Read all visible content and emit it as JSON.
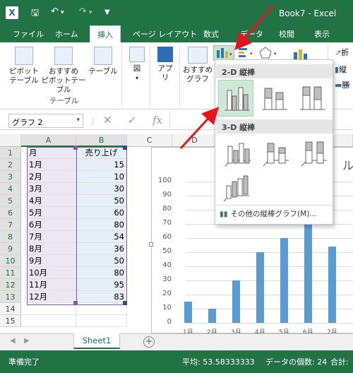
{
  "window": {
    "title": "Book7 - Excel"
  },
  "tabs": [
    "ファイル",
    "ホーム",
    "挿入",
    "ページ レイアウト",
    "数式",
    "データ",
    "校閲",
    "表示"
  ],
  "ribbon": {
    "pivot_table": "ピボット\nテーブル",
    "recommended_pivot": "おすすめ\nピボットテーブル",
    "table": "テーブル",
    "table_group": "テーブル",
    "illustrations": "図",
    "apps": "アプ\nリ",
    "recommended_charts": "おすすめ\nグラフ",
    "right_labels": [
      "折",
      "縦",
      "勝"
    ]
  },
  "formula_bar": {
    "name_box": "グラフ 2"
  },
  "grid": {
    "columns": [
      "A",
      "B",
      "C",
      "D",
      "E",
      "F",
      "G"
    ],
    "rows": [
      "1",
      "2",
      "3",
      "4",
      "5",
      "6",
      "7",
      "8",
      "9",
      "10",
      "11",
      "12",
      "13",
      "14",
      "15"
    ],
    "header": {
      "month": "月",
      "sales": "売り上げ"
    },
    "data": [
      {
        "m": "1月",
        "v": "15"
      },
      {
        "m": "2月",
        "v": "10"
      },
      {
        "m": "3月",
        "v": "30"
      },
      {
        "m": "4月",
        "v": "50"
      },
      {
        "m": "5月",
        "v": "60"
      },
      {
        "m": "6月",
        "v": "80"
      },
      {
        "m": "7月",
        "v": "54"
      },
      {
        "m": "8月",
        "v": "36"
      },
      {
        "m": "9月",
        "v": "50"
      },
      {
        "m": "10月",
        "v": "80"
      },
      {
        "m": "11月",
        "v": "95"
      },
      {
        "m": "12月",
        "v": "83"
      }
    ]
  },
  "chart_data": {
    "type": "bar",
    "categories": [
      "1月",
      "2月",
      "3月",
      "4月",
      "5月",
      "6月",
      "7月"
    ],
    "values": [
      15,
      10,
      30,
      50,
      60,
      80,
      54
    ],
    "y_ticks": [
      "100",
      "90",
      "80",
      "70",
      "60",
      "50",
      "40",
      "30",
      "20",
      "10",
      "0"
    ],
    "ylim": [
      0,
      100
    ],
    "title_fragment": "ル",
    "bar_color": "#5b9bd5"
  },
  "dropdown": {
    "section_2d": "2-D 縦棒",
    "section_3d": "3-D 縦棒",
    "more": "その他の縦棒グラフ(M)..."
  },
  "sheet_tab": "Sheet1",
  "status": {
    "ready": "準備完了",
    "average": "平均: 53.58333333",
    "count": "データの個数: 24",
    "sum": "合計:"
  },
  "colors": {
    "excel_green": "#217346",
    "arrow_red": "#e8141c"
  }
}
